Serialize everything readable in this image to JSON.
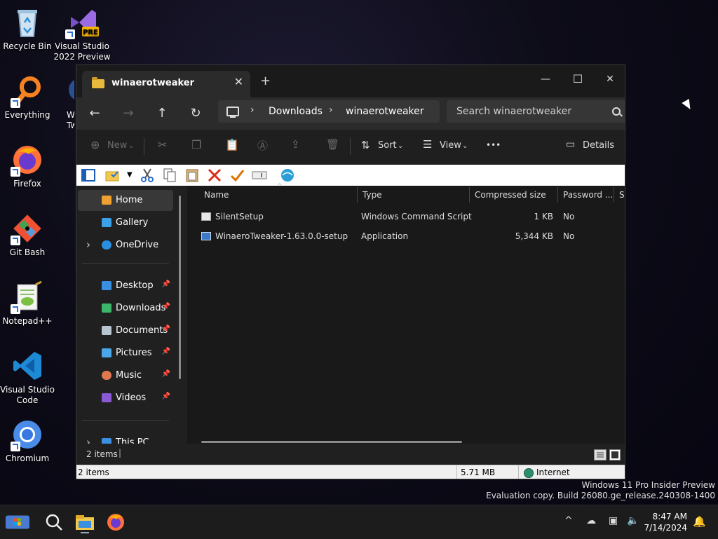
{
  "desktop": {
    "icons": [
      {
        "label": "Recycle Bin",
        "icon": "recycle-bin-icon"
      },
      {
        "label": "Visual Studio 2022 Preview",
        "badge": "PRE",
        "icon": "visual-studio-icon"
      },
      {
        "label": "Everything",
        "icon": "everything-search-icon"
      },
      {
        "label": "Wi Tw",
        "icon": "winaero-tweaker-icon"
      },
      {
        "label": "Firefox",
        "icon": "firefox-icon"
      },
      {
        "label": "Git Bash",
        "icon": "git-bash-icon"
      },
      {
        "label": "Notepad++",
        "icon": "notepad-plus-plus-icon"
      },
      {
        "label": "Visual Studio Code",
        "icon": "vscode-icon"
      },
      {
        "label": "Chromium",
        "icon": "chromium-icon"
      }
    ]
  },
  "explorer": {
    "tab_title": "winaerotweaker",
    "tab_close": "✕",
    "new_tab": "+",
    "window_controls": {
      "minimize": "—",
      "maximize": "☐",
      "close": "✕"
    },
    "nav": {
      "back": "←",
      "forward": "→",
      "up": "↑",
      "refresh": "↻"
    },
    "breadcrumbs": [
      "Downloads",
      "winaerotweaker"
    ],
    "search_placeholder": "Search winaerotweaker",
    "commands": {
      "new": "New",
      "sort": "Sort",
      "view": "View",
      "more": "•••",
      "details": "Details"
    },
    "nav_pane": {
      "top": [
        {
          "label": "Home",
          "color": "#f0a030"
        },
        {
          "label": "Gallery",
          "color": "#3aa0e8"
        },
        {
          "label": "OneDrive",
          "color": "#2b8ee0"
        }
      ],
      "quick_access": [
        {
          "label": "Desktop",
          "color": "#3a8fe0"
        },
        {
          "label": "Downloads",
          "color": "#3bb66a"
        },
        {
          "label": "Documents",
          "color": "#b8c4d0"
        },
        {
          "label": "Pictures",
          "color": "#4aa6e8"
        },
        {
          "label": "Music",
          "color": "#e07850"
        },
        {
          "label": "Videos",
          "color": "#8a5ad6"
        }
      ],
      "bottom": [
        {
          "label": "This PC",
          "color": "#3a8fe0"
        }
      ],
      "pin": "📌",
      "expand": "›"
    },
    "columns": [
      "Name",
      "Type",
      "Compressed size",
      "Password ...",
      "Si"
    ],
    "files": [
      {
        "name": "SilentSetup",
        "type": "Windows Command Script",
        "size": "1 KB",
        "password": "No"
      },
      {
        "name": "WinaeroTweaker-1.63.0.0-setup",
        "type": "Application",
        "size": "5,344 KB",
        "password": "No"
      }
    ],
    "item_count": "2 items",
    "status": {
      "items": "2 items",
      "size": "5.71 MB",
      "zone": "Internet"
    }
  },
  "watermark": {
    "line1": "Windows 11 Pro Insider Preview",
    "line2": "Evaluation copy. Build 26080.ge_release.240308-1400"
  },
  "taskbar": {
    "time": "8:47 AM",
    "date": "7/14/2024",
    "tray_chevron": "^"
  }
}
